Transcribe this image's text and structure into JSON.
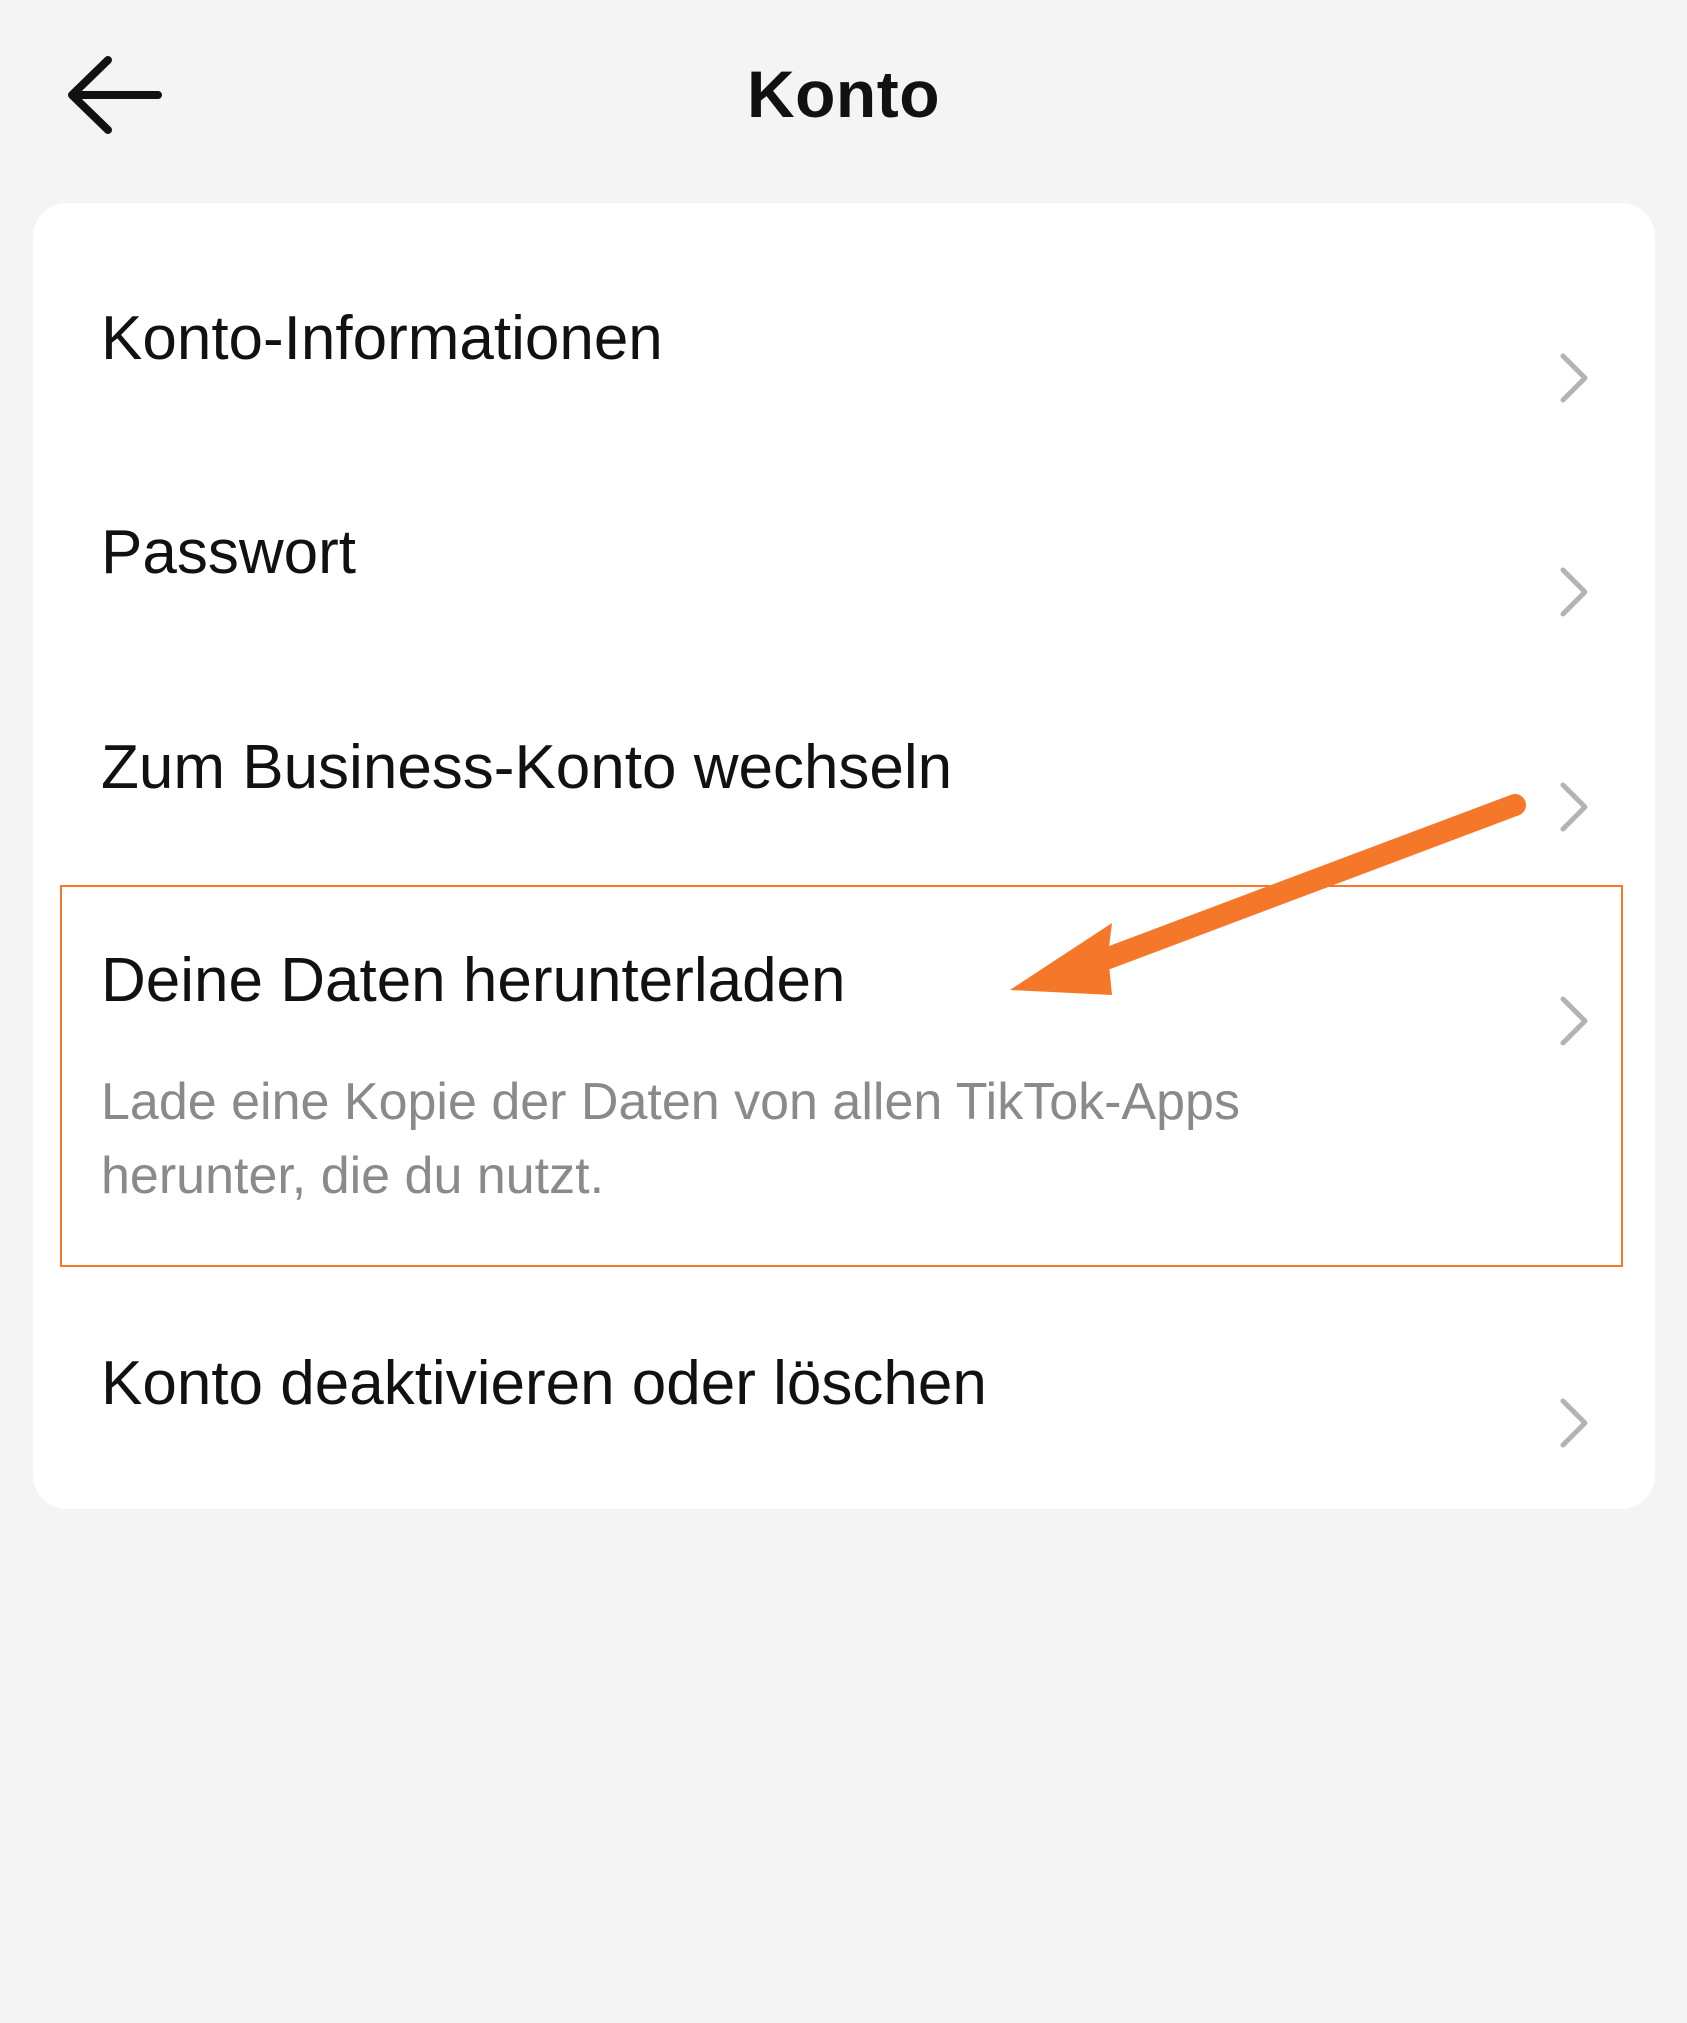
{
  "header": {
    "title": "Konto",
    "back_icon": "arrow-left-icon"
  },
  "settings": {
    "items": [
      {
        "label": "Konto-Informationen",
        "icon": "chevron-right-icon"
      },
      {
        "label": "Passwort",
        "icon": "chevron-right-icon"
      },
      {
        "label": "Zum Business-Konto wechseln",
        "icon": "chevron-right-icon"
      },
      {
        "label": "Deine Daten herunterladen",
        "description": "Lade eine Kopie der Daten von allen TikTok-Apps herunter, die du nutzt.",
        "icon": "chevron-right-icon",
        "highlighted": true
      },
      {
        "label": "Konto deaktivieren oder löschen",
        "icon": "chevron-right-icon"
      }
    ]
  },
  "colors": {
    "background": "#f4f4f4",
    "card": "#ffffff",
    "text": "#111111",
    "secondary_text": "#8a8a8a",
    "chevron": "#b3b3b3",
    "annotation": "#f5782a"
  }
}
